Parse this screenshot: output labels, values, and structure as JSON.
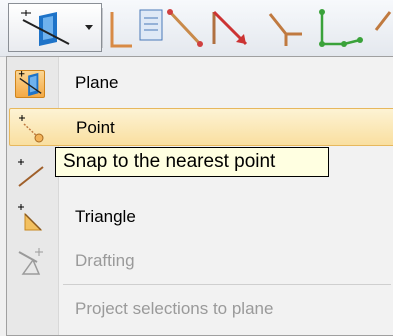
{
  "toolbar": {
    "mode_dropdown_icon": "plane-snap-icon",
    "buttons": [
      {
        "icon": "polyline-corner-icon"
      },
      {
        "icon": "notes-icon"
      },
      {
        "icon": "line-segment-icon"
      },
      {
        "icon": "arrow-line-icon"
      },
      {
        "icon": "y-junction-icon"
      },
      {
        "icon": "green-polyline-icon"
      },
      {
        "icon": "partial-tool-icon"
      }
    ]
  },
  "menu": {
    "items": [
      {
        "label": "Plane",
        "icon": "plane-snap-icon",
        "state": "checked"
      },
      {
        "label": "Point",
        "icon": "point-snap-icon",
        "state": "highlighted"
      },
      {
        "label": "",
        "icon": "nearest-line-icon",
        "state": "normal"
      },
      {
        "label": "Triangle",
        "icon": "triangle-snap-icon",
        "state": "normal"
      },
      {
        "label": "Drafting",
        "icon": "drafting-icon",
        "state": "disabled"
      },
      {
        "label": "Project selections to plane",
        "icon": "",
        "state": "disabled"
      }
    ]
  },
  "tooltip": {
    "text": "Snap to the nearest point"
  },
  "colors": {
    "highlight": "#f9dfa0",
    "checked": "#f3a945",
    "tooltip_bg": "#ffffe1",
    "accent_blue": "#1e73c8",
    "accent_red": "#cc3333",
    "accent_green": "#3aa23a"
  }
}
